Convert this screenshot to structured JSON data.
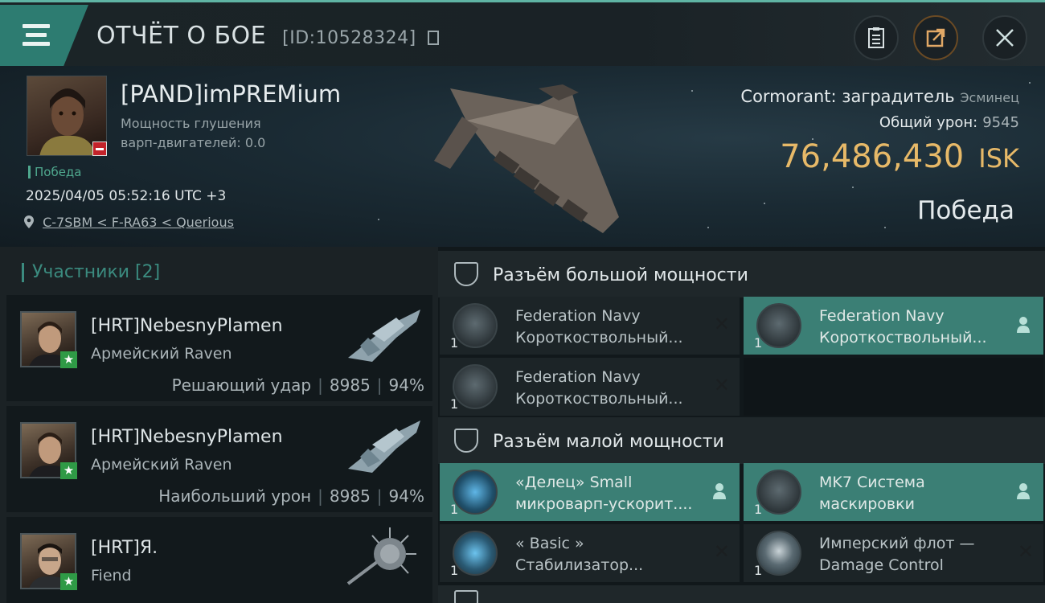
{
  "header": {
    "title": "ОТЧЁТ О БОЕ",
    "report_id": "[ID:10528324]",
    "icons": [
      "menu-icon",
      "copy-icon",
      "clipboard-icon",
      "share-icon",
      "close-icon"
    ]
  },
  "victim": {
    "name": "[PAND]imPREMium",
    "warp_label": "Мощность глушения",
    "warp_value": "варп-двигателей: 0.0",
    "status_tag": "Победа",
    "datetime": "2025/04/05 05:52:16 UTC +3",
    "location": "C-7SBM < F-RA63 < Querious",
    "ship_name": "Cormorant: заградитель",
    "ship_class": "Эсминец",
    "damage_label": "Общий урон:",
    "damage_value": "9545",
    "isk_amount": "76,486,430",
    "isk_currency": "ISK",
    "result": "Победа"
  },
  "participants": {
    "heading": "Участники [2]",
    "rows": [
      {
        "name": "[HRT]NebesnyPlamen",
        "ship": "Армейский Raven",
        "role": "Решающий удар",
        "damage": "8985",
        "percent": "94%"
      },
      {
        "name": "[HRT]NebesnyPlamen",
        "ship": "Армейский Raven",
        "role": "Наибольший урон",
        "damage": "8985",
        "percent": "94%"
      },
      {
        "name": "[HRT]Я.",
        "ship": "Fiend",
        "role": "",
        "damage": "",
        "percent": ""
      }
    ]
  },
  "sections": {
    "high": "Разъём большой мощности",
    "low": "Разъём малой мощности"
  },
  "high_modules": [
    {
      "line1": "Federation Navy",
      "line2": "Короткоствольный...",
      "qty": "1",
      "state": "destroyed"
    },
    {
      "line1": "Federation Navy",
      "line2": "Короткоствольный...",
      "qty": "1",
      "state": "dropped"
    },
    {
      "line1": "Federation Navy",
      "line2": "Короткоствольный...",
      "qty": "1",
      "state": "destroyed"
    }
  ],
  "low_modules": [
    {
      "line1": "«Делец» Small",
      "line2": "микроварп-ускорит....",
      "qty": "1",
      "state": "dropped"
    },
    {
      "line1": "MK7 Система",
      "line2": "маскировки",
      "qty": "1",
      "state": "dropped"
    },
    {
      "line1": "« Basic »",
      "line2": "Стабилизатор...",
      "qty": "1",
      "state": "destroyed"
    },
    {
      "line1": "Имперский флот —",
      "line2": "Damage Control",
      "qty": "1",
      "state": "destroyed"
    }
  ],
  "colors": {
    "accent": "#3b7f75",
    "isk": "#e7b968",
    "victory": "#4fa88e",
    "star_badge": "#2f9a46",
    "red_badge": "#c3232a"
  }
}
